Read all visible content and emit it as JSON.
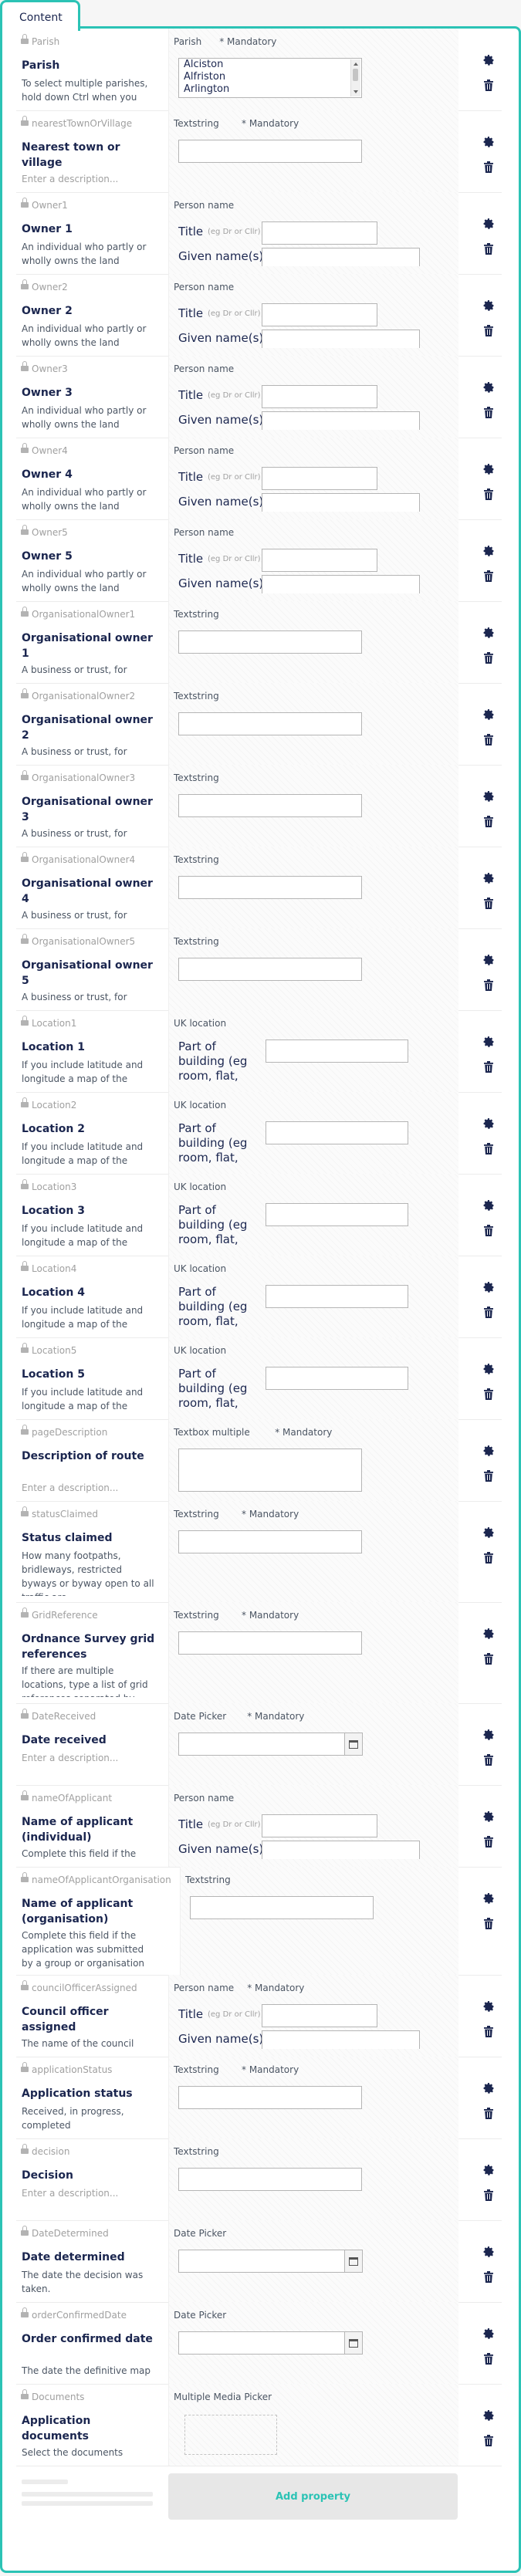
{
  "tab": {
    "label": "Content"
  },
  "people": {
    "title_label": "Title",
    "title_hint": "(eg Dr or Cllr)",
    "given_label": "Given name(s)"
  },
  "location": {
    "field_label": "Part of building (eg room, flat, floor)"
  },
  "mandatory_label": "* Mandatory",
  "add_property_label": "Add property",
  "parish_options": [
    "Alciston",
    "Alfriston",
    "Arlington"
  ],
  "properties": [
    {
      "alias": "Parish",
      "name": "Parish",
      "description": "To select multiple parishes, hold down Ctrl when you select a",
      "editor_type": "Parish",
      "mandatory": true,
      "kind": "listbox"
    },
    {
      "alias": "nearestTownOrVillage",
      "name": "Nearest town or village",
      "description": "Enter a description...",
      "placeholder": true,
      "editor_type": "Textstring",
      "mandatory": true,
      "kind": "input"
    },
    {
      "alias": "Owner1",
      "name": "Owner 1",
      "description": "An individual who partly or wholly owns the land",
      "editor_type": "Person name",
      "kind": "person"
    },
    {
      "alias": "Owner2",
      "name": "Owner 2",
      "description": "An individual who partly or wholly owns the land",
      "editor_type": "Person name",
      "kind": "person"
    },
    {
      "alias": "Owner3",
      "name": "Owner 3",
      "description": "An individual who partly or wholly owns the land",
      "editor_type": "Person name",
      "kind": "person"
    },
    {
      "alias": "Owner4",
      "name": "Owner 4",
      "description": "An individual who partly or wholly owns the land",
      "editor_type": "Person name",
      "kind": "person"
    },
    {
      "alias": "Owner5",
      "name": "Owner 5",
      "description": "An individual who partly or wholly owns the land",
      "editor_type": "Person name",
      "kind": "person"
    },
    {
      "alias": "OrganisationalOwner1",
      "name": "Organisational owner 1",
      "description": "A business or trust, for example, that partly or wholly owns the",
      "editor_type": "Textstring",
      "kind": "input"
    },
    {
      "alias": "OrganisationalOwner2",
      "name": "Organisational owner 2",
      "description": "A business or trust, for example, that partly or wholly owns the",
      "editor_type": "Textstring",
      "kind": "input"
    },
    {
      "alias": "OrganisationalOwner3",
      "name": "Organisational owner 3",
      "description": "A business or trust, for example, that partly or wholly owns the",
      "editor_type": "Textstring",
      "kind": "input"
    },
    {
      "alias": "OrganisationalOwner4",
      "name": "Organisational owner 4",
      "description": "A business or trust, for example, that partly or wholly owns the",
      "editor_type": "Textstring",
      "kind": "input"
    },
    {
      "alias": "OrganisationalOwner5",
      "name": "Organisational owner 5",
      "description": "A business or trust, for example, that partly or wholly owns the",
      "editor_type": "Textstring",
      "kind": "input"
    },
    {
      "alias": "Location1",
      "name": "Location 1",
      "description": "If you include latitude and longitude a map of the location",
      "editor_type": "UK location",
      "kind": "location"
    },
    {
      "alias": "Location2",
      "name": "Location 2",
      "description": "If you include latitude and longitude a map of the location",
      "editor_type": "UK location",
      "kind": "location"
    },
    {
      "alias": "Location3",
      "name": "Location 3",
      "description": "If you include latitude and longitude a map of the location",
      "editor_type": "UK location",
      "kind": "location"
    },
    {
      "alias": "Location4",
      "name": "Location 4",
      "description": "If you include latitude and longitude a map of the location",
      "editor_type": "UK location",
      "kind": "location"
    },
    {
      "alias": "Location5",
      "name": "Location 5",
      "description": "If you include latitude and longitude a map of the location",
      "editor_type": "UK location",
      "kind": "location"
    },
    {
      "alias": "pageDescription",
      "name": "Description of route",
      "description": "Enter a description...",
      "placeholder": true,
      "editor_type": "Textbox multiple",
      "mandatory": true,
      "kind": "textarea"
    },
    {
      "alias": "statusClaimed",
      "name": "Status claimed",
      "description": "How many footpaths, bridleways, restricted byways or byway open to all traffic are",
      "editor_type": "Textstring",
      "mandatory": true,
      "kind": "input"
    },
    {
      "alias": "GridReference",
      "name": "Ordnance Survey grid references",
      "description": "If there are multiple locations, type a list of grid references separated by commas",
      "editor_type": "Textstring",
      "mandatory": true,
      "kind": "input"
    },
    {
      "alias": "DateReceived",
      "name": "Date received",
      "description": "Enter a description...",
      "placeholder": true,
      "editor_type": "Date Picker",
      "mandatory": true,
      "kind": "date"
    },
    {
      "alias": "nameOfApplicant",
      "name": "Name of applicant (individual)",
      "description": "Complete this field if the application was submitted by an",
      "editor_type": "Person name",
      "kind": "person"
    },
    {
      "alias": "nameOfApplicantOrganisation",
      "name": "Name of applicant (organisation)",
      "description": "Complete this field if the application was submitted by a group or organisation",
      "editor_type": "Textstring",
      "kind": "input",
      "wide": true
    },
    {
      "alias": "councilOfficerAssigned",
      "name": "Council officer assigned",
      "description": "The name of the council officer assigned to process the",
      "editor_type": "Person name",
      "mandatory": true,
      "kind": "person"
    },
    {
      "alias": "applicationStatus",
      "name": "Application status",
      "description": "Received, in progress, completed",
      "editor_type": "Textstring",
      "mandatory": true,
      "kind": "input"
    },
    {
      "alias": "decision",
      "name": "Decision",
      "description": "Enter a description...",
      "placeholder": true,
      "editor_type": "Textstring",
      "kind": "input"
    },
    {
      "alias": "DateDetermined",
      "name": "Date determined",
      "description": "The date the decision was taken.",
      "editor_type": "Date Picker",
      "kind": "date"
    },
    {
      "alias": "orderConfirmedDate",
      "name": "Order confirmed date",
      "description": "The date the definitive map modification order was",
      "editor_type": "Date Picker",
      "kind": "date"
    },
    {
      "alias": "Documents",
      "name": "Application documents",
      "description": "Select the documents submitted as part of the application",
      "editor_type": "Multiple Media Picker",
      "kind": "media"
    }
  ]
}
